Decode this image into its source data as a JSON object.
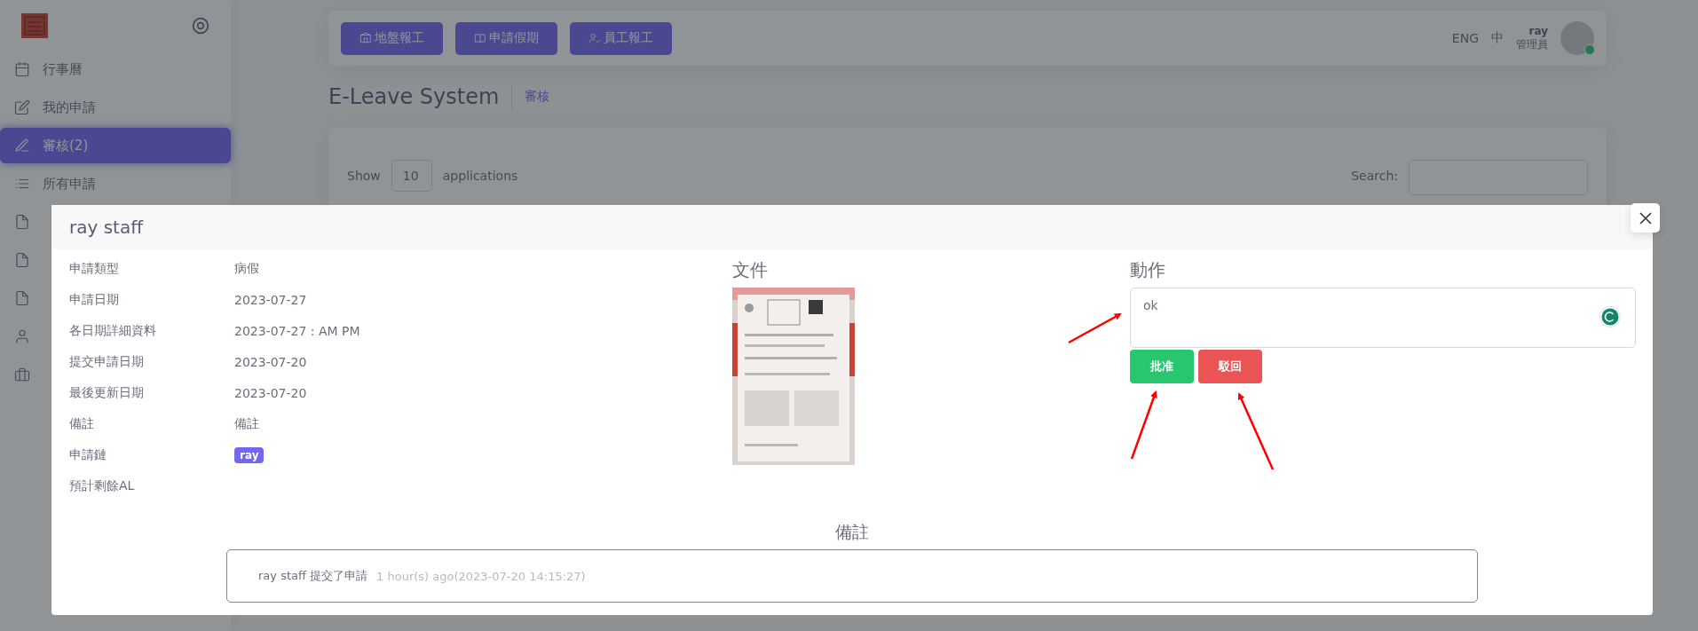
{
  "sidebar": {
    "items": [
      {
        "label": "行事曆",
        "selected": false
      },
      {
        "label": "我的申請",
        "selected": false
      },
      {
        "label": "審核(2)",
        "selected": true
      },
      {
        "label": "所有申請",
        "selected": false
      },
      {
        "selected": false
      },
      {
        "selected": false
      },
      {
        "selected": false
      },
      {
        "selected": false
      },
      {
        "selected": false
      }
    ]
  },
  "topbar": {
    "buttons": [
      "地盤報工",
      "申請假期",
      "員工報工"
    ],
    "languages": [
      "ENG",
      "中"
    ],
    "user": {
      "name": "ray",
      "role": "管理員",
      "online": true
    }
  },
  "page": {
    "title": "E-Leave System",
    "breadcrumb": "審核",
    "show_label": "Show",
    "page_size": "10",
    "after_label": "applications",
    "search_label": "Search:"
  },
  "modal": {
    "title": "ray staff",
    "details": [
      {
        "label": "申請類型",
        "value": "病假"
      },
      {
        "label": "申請日期",
        "value": "2023-07-27"
      },
      {
        "label": "各日期詳細資料",
        "value": "2023-07-27 : AM PM"
      },
      {
        "label": "提交申請日期",
        "value": "2023-07-20"
      },
      {
        "label": "最後更新日期",
        "value": "2023-07-20"
      },
      {
        "label": "備註",
        "value": "備註"
      },
      {
        "label": "申請鏈",
        "value": "ray",
        "kind": "tag"
      },
      {
        "label": "預計剩餘AL"
      }
    ],
    "document_heading": "文件",
    "action_heading": "動作",
    "comment": "ok",
    "buttons": [
      {
        "label": "批准",
        "kind": "approve"
      },
      {
        "label": "駁回",
        "kind": "reject"
      }
    ],
    "remarks_heading": "備註",
    "log": [
      {
        "text": "ray staff 提交了申請",
        "time": "1 hour(s) ago(2023-07-20 14:15:27)"
      }
    ]
  }
}
